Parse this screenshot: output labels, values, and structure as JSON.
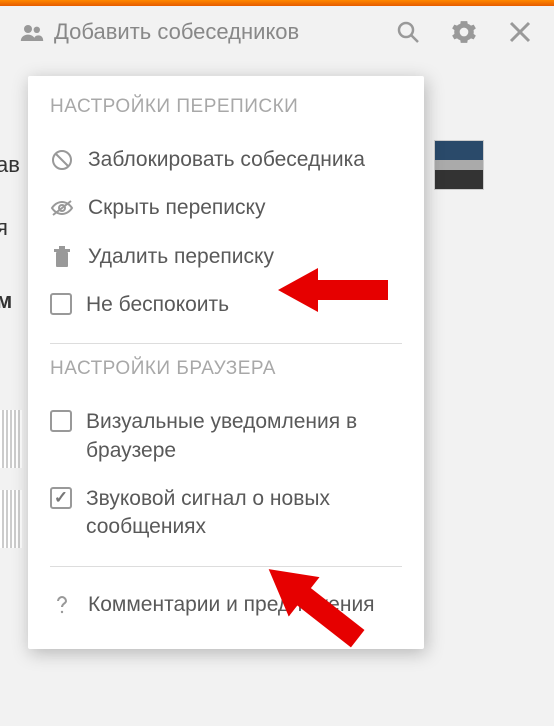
{
  "header": {
    "title": "Добавить собеседников"
  },
  "dropdown": {
    "section1_title": "НАСТРОЙКИ ПЕРЕПИСКИ",
    "section2_title": "НАСТРОЙКИ БРАУЗЕРА",
    "items1": {
      "block": "Заблокировать собеседника",
      "hide": "Скрыть переписку",
      "delete": "Удалить переписку",
      "dnd": "Не беспокоить"
    },
    "items2": {
      "visual": "Визуальные уведомления в браузере",
      "sound": "Звуковой сигнал о новых сообщениях"
    },
    "footer": "Комментарии и предложения"
  },
  "bg": {
    "frag1": "ав",
    "frag2": "я",
    "frag3": "м"
  }
}
